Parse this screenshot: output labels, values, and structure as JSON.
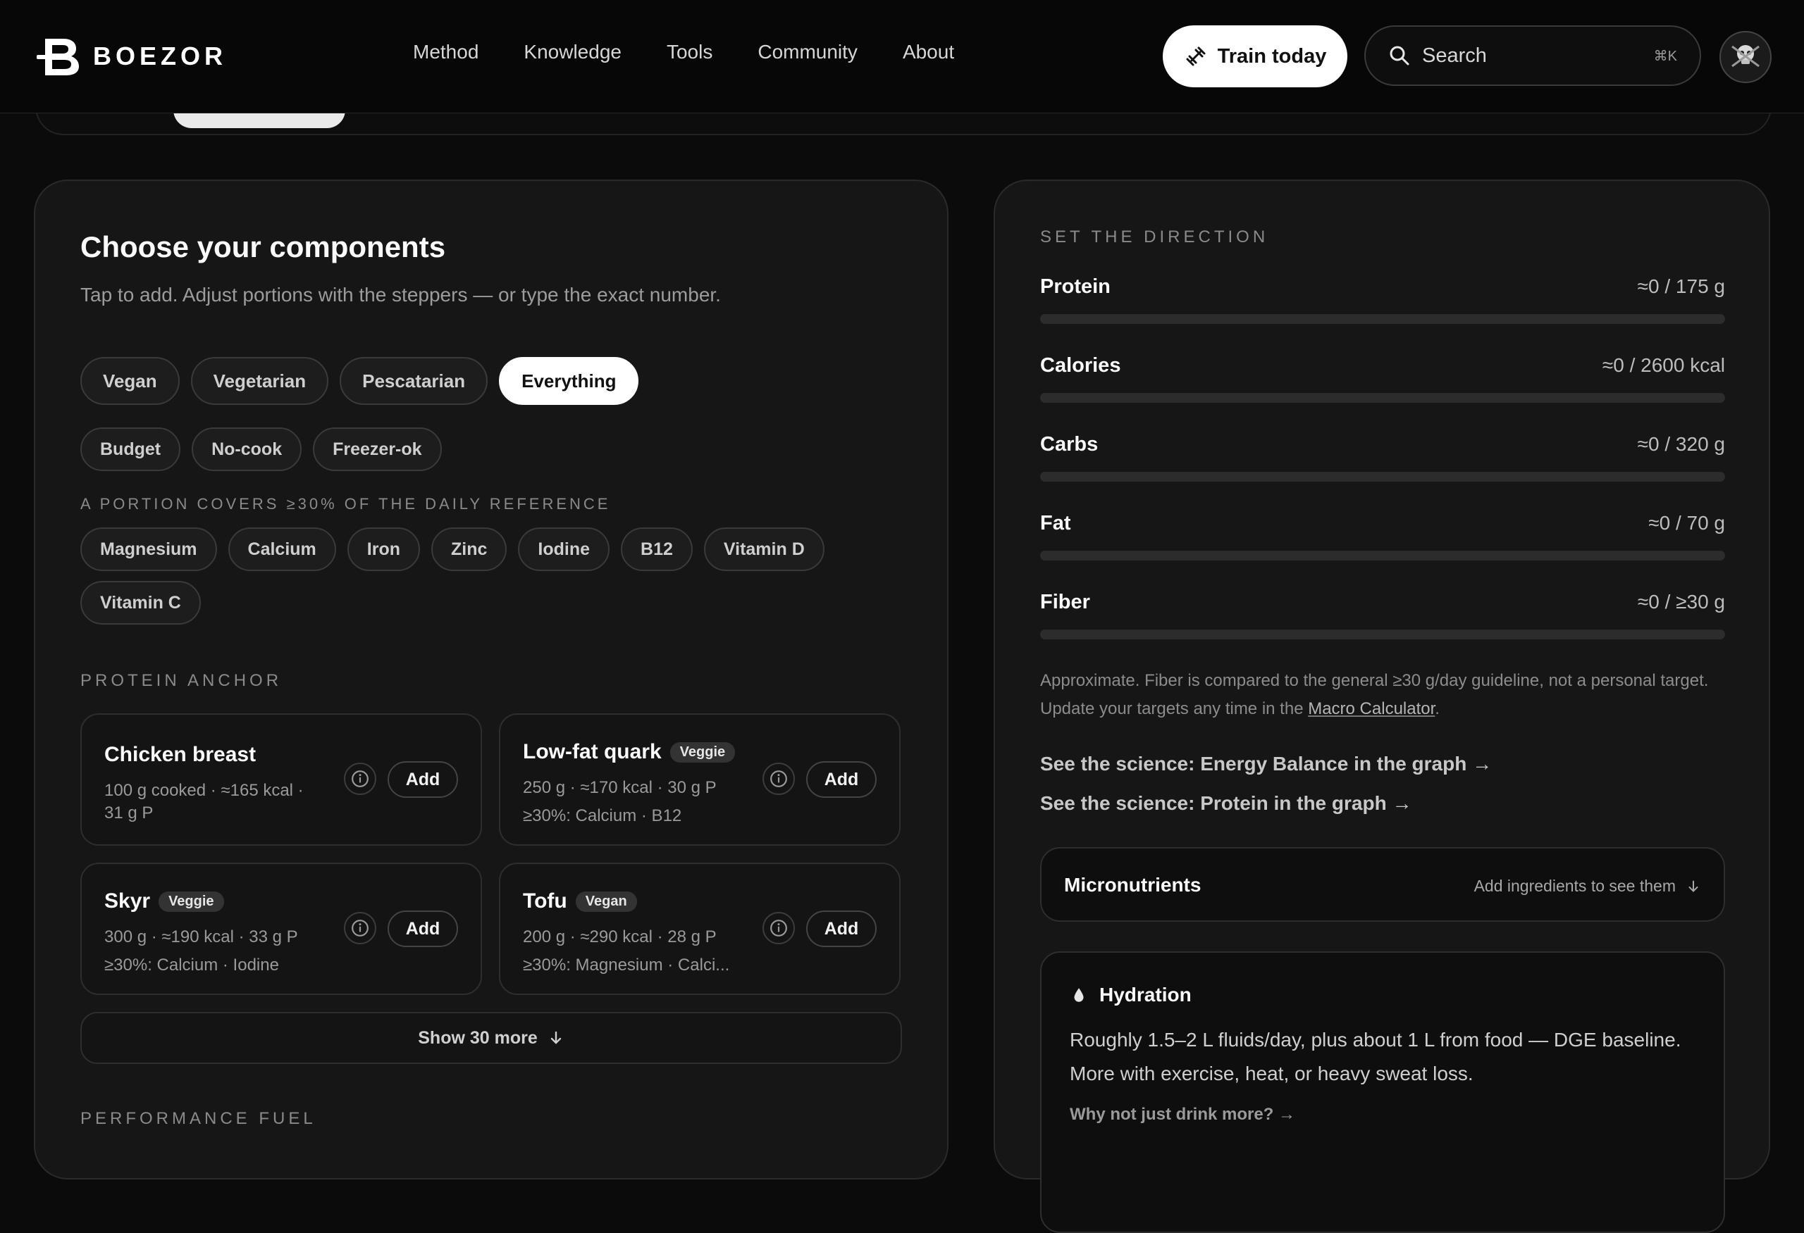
{
  "header": {
    "brand": "BOEZOR",
    "nav": [
      "Method",
      "Knowledge",
      "Tools",
      "Community",
      "About"
    ],
    "train_label": "Train today",
    "search_placeholder": "Search",
    "search_shortcut": "⌘K"
  },
  "left": {
    "title": "Choose your components",
    "subtitle": "Tap to add. Adjust portions with the steppers — or type the exact number.",
    "diet_filters": [
      {
        "label": "Vegan",
        "active": false
      },
      {
        "label": "Vegetarian",
        "active": false
      },
      {
        "label": "Pescatarian",
        "active": false
      },
      {
        "label": "Everything",
        "active": true
      }
    ],
    "extra_filters": [
      "Budget",
      "No-cook",
      "Freezer-ok"
    ],
    "micro_heading": "A PORTION COVERS ≥30% OF THE DAILY REFERENCE",
    "micro_filters": [
      "Magnesium",
      "Calcium",
      "Iron",
      "Zinc",
      "Iodine",
      "B12",
      "Vitamin D",
      "Vitamin C"
    ],
    "section_title": "PROTEIN ANCHOR",
    "cards": [
      {
        "name": "Chicken breast",
        "badge": "",
        "line1": "100 g cooked · ≈165 kcal ·",
        "line2": "31 g P",
        "add": "Add"
      },
      {
        "name": "Low-fat quark",
        "badge": "Veggie",
        "line1": "250 g · ≈170 kcal · 30 g P",
        "line2": "≥30%: Calcium · B12",
        "add": "Add"
      },
      {
        "name": "Skyr",
        "badge": "Veggie",
        "line1": "300 g · ≈190 kcal · 33 g P",
        "line2": "≥30%: Calcium · Iodine",
        "add": "Add"
      },
      {
        "name": "Tofu",
        "badge": "Vegan",
        "line1": "200 g · ≈290 kcal · 28 g P",
        "line2": "≥30%: Magnesium · Calci...",
        "add": "Add"
      }
    ],
    "show_more": "Show 30 more",
    "next_section": "PERFORMANCE FUEL"
  },
  "right": {
    "heading": "SET THE DIRECTION",
    "macros": [
      {
        "name": "Protein",
        "value": "≈0 / 175 g",
        "progress": 0
      },
      {
        "name": "Calories",
        "value": "≈0 / 2600 kcal",
        "progress": 0
      },
      {
        "name": "Carbs",
        "value": "≈0 / 320 g",
        "progress": 0
      },
      {
        "name": "Fat",
        "value": "≈0 / 70 g",
        "progress": 0
      },
      {
        "name": "Fiber",
        "value": "≈0 / ≥30 g",
        "progress": 0
      }
    ],
    "note_text": "Approximate. Fiber is compared to the general ≥30 g/day guideline, not a personal target. Update your targets any time in the ",
    "note_link": "Macro Calculator",
    "note_end": ".",
    "science_links": [
      "See the science: Energy Balance in the graph →",
      "See the science: Protein in the graph →"
    ],
    "micronutrients_title": "Micronutrients",
    "micronutrients_hint": "Add ingredients to see them",
    "hydration_title": "Hydration",
    "hydration_body": "Roughly 1.5–2 L fluids/day, plus about 1 L from food — DGE baseline. More with exercise, heat, or heavy sweat loss.",
    "hydration_link": "Why not just drink more? →"
  }
}
